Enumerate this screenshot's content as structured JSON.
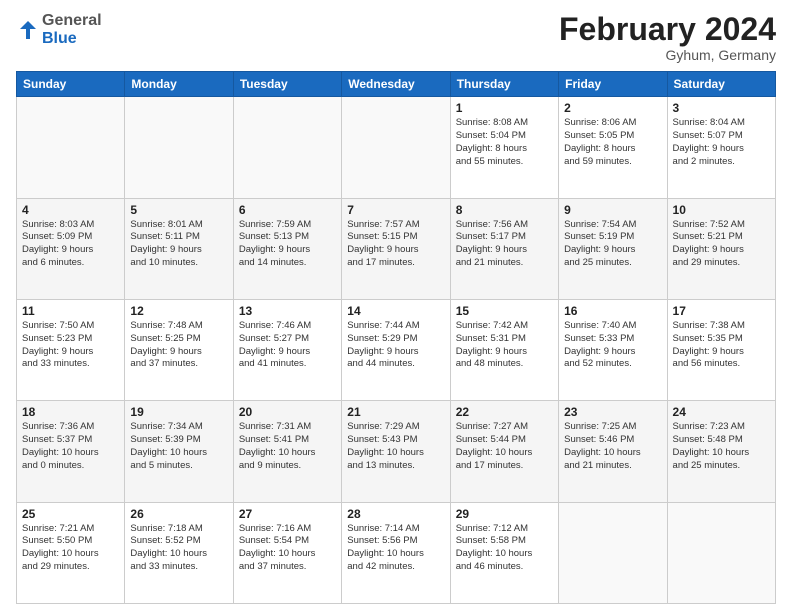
{
  "header": {
    "logo_general": "General",
    "logo_blue": "Blue",
    "title": "February 2024",
    "location": "Gyhum, Germany"
  },
  "weekdays": [
    "Sunday",
    "Monday",
    "Tuesday",
    "Wednesday",
    "Thursday",
    "Friday",
    "Saturday"
  ],
  "weeks": [
    {
      "shaded": false,
      "days": [
        {
          "num": "",
          "text": ""
        },
        {
          "num": "",
          "text": ""
        },
        {
          "num": "",
          "text": ""
        },
        {
          "num": "",
          "text": ""
        },
        {
          "num": "1",
          "text": "Sunrise: 8:08 AM\nSunset: 5:04 PM\nDaylight: 8 hours\nand 55 minutes."
        },
        {
          "num": "2",
          "text": "Sunrise: 8:06 AM\nSunset: 5:05 PM\nDaylight: 8 hours\nand 59 minutes."
        },
        {
          "num": "3",
          "text": "Sunrise: 8:04 AM\nSunset: 5:07 PM\nDaylight: 9 hours\nand 2 minutes."
        }
      ]
    },
    {
      "shaded": true,
      "days": [
        {
          "num": "4",
          "text": "Sunrise: 8:03 AM\nSunset: 5:09 PM\nDaylight: 9 hours\nand 6 minutes."
        },
        {
          "num": "5",
          "text": "Sunrise: 8:01 AM\nSunset: 5:11 PM\nDaylight: 9 hours\nand 10 minutes."
        },
        {
          "num": "6",
          "text": "Sunrise: 7:59 AM\nSunset: 5:13 PM\nDaylight: 9 hours\nand 14 minutes."
        },
        {
          "num": "7",
          "text": "Sunrise: 7:57 AM\nSunset: 5:15 PM\nDaylight: 9 hours\nand 17 minutes."
        },
        {
          "num": "8",
          "text": "Sunrise: 7:56 AM\nSunset: 5:17 PM\nDaylight: 9 hours\nand 21 minutes."
        },
        {
          "num": "9",
          "text": "Sunrise: 7:54 AM\nSunset: 5:19 PM\nDaylight: 9 hours\nand 25 minutes."
        },
        {
          "num": "10",
          "text": "Sunrise: 7:52 AM\nSunset: 5:21 PM\nDaylight: 9 hours\nand 29 minutes."
        }
      ]
    },
    {
      "shaded": false,
      "days": [
        {
          "num": "11",
          "text": "Sunrise: 7:50 AM\nSunset: 5:23 PM\nDaylight: 9 hours\nand 33 minutes."
        },
        {
          "num": "12",
          "text": "Sunrise: 7:48 AM\nSunset: 5:25 PM\nDaylight: 9 hours\nand 37 minutes."
        },
        {
          "num": "13",
          "text": "Sunrise: 7:46 AM\nSunset: 5:27 PM\nDaylight: 9 hours\nand 41 minutes."
        },
        {
          "num": "14",
          "text": "Sunrise: 7:44 AM\nSunset: 5:29 PM\nDaylight: 9 hours\nand 44 minutes."
        },
        {
          "num": "15",
          "text": "Sunrise: 7:42 AM\nSunset: 5:31 PM\nDaylight: 9 hours\nand 48 minutes."
        },
        {
          "num": "16",
          "text": "Sunrise: 7:40 AM\nSunset: 5:33 PM\nDaylight: 9 hours\nand 52 minutes."
        },
        {
          "num": "17",
          "text": "Sunrise: 7:38 AM\nSunset: 5:35 PM\nDaylight: 9 hours\nand 56 minutes."
        }
      ]
    },
    {
      "shaded": true,
      "days": [
        {
          "num": "18",
          "text": "Sunrise: 7:36 AM\nSunset: 5:37 PM\nDaylight: 10 hours\nand 0 minutes."
        },
        {
          "num": "19",
          "text": "Sunrise: 7:34 AM\nSunset: 5:39 PM\nDaylight: 10 hours\nand 5 minutes."
        },
        {
          "num": "20",
          "text": "Sunrise: 7:31 AM\nSunset: 5:41 PM\nDaylight: 10 hours\nand 9 minutes."
        },
        {
          "num": "21",
          "text": "Sunrise: 7:29 AM\nSunset: 5:43 PM\nDaylight: 10 hours\nand 13 minutes."
        },
        {
          "num": "22",
          "text": "Sunrise: 7:27 AM\nSunset: 5:44 PM\nDaylight: 10 hours\nand 17 minutes."
        },
        {
          "num": "23",
          "text": "Sunrise: 7:25 AM\nSunset: 5:46 PM\nDaylight: 10 hours\nand 21 minutes."
        },
        {
          "num": "24",
          "text": "Sunrise: 7:23 AM\nSunset: 5:48 PM\nDaylight: 10 hours\nand 25 minutes."
        }
      ]
    },
    {
      "shaded": false,
      "days": [
        {
          "num": "25",
          "text": "Sunrise: 7:21 AM\nSunset: 5:50 PM\nDaylight: 10 hours\nand 29 minutes."
        },
        {
          "num": "26",
          "text": "Sunrise: 7:18 AM\nSunset: 5:52 PM\nDaylight: 10 hours\nand 33 minutes."
        },
        {
          "num": "27",
          "text": "Sunrise: 7:16 AM\nSunset: 5:54 PM\nDaylight: 10 hours\nand 37 minutes."
        },
        {
          "num": "28",
          "text": "Sunrise: 7:14 AM\nSunset: 5:56 PM\nDaylight: 10 hours\nand 42 minutes."
        },
        {
          "num": "29",
          "text": "Sunrise: 7:12 AM\nSunset: 5:58 PM\nDaylight: 10 hours\nand 46 minutes."
        },
        {
          "num": "",
          "text": ""
        },
        {
          "num": "",
          "text": ""
        }
      ]
    }
  ]
}
